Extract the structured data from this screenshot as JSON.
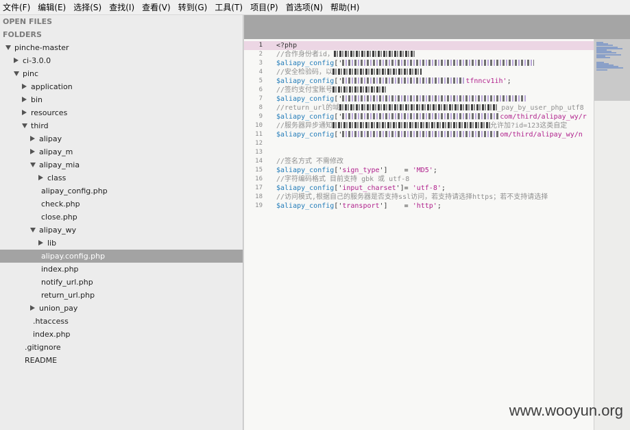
{
  "menu": [
    "文件(F)",
    "编辑(E)",
    "选择(S)",
    "查找(I)",
    "查看(V)",
    "转到(G)",
    "工具(T)",
    "项目(P)",
    "首选项(N)",
    "帮助(H)"
  ],
  "sidebar": {
    "open_files_label": "OPEN FILES",
    "folders_label": "FOLDERS",
    "tree": [
      {
        "label": "pinche-master",
        "depth": 0,
        "state": "open"
      },
      {
        "label": "ci-3.0.0",
        "depth": 1,
        "state": "closed"
      },
      {
        "label": "pinc",
        "depth": 1,
        "state": "open"
      },
      {
        "label": "application",
        "depth": 2,
        "state": "closed"
      },
      {
        "label": "bin",
        "depth": 2,
        "state": "closed"
      },
      {
        "label": "resources",
        "depth": 2,
        "state": "closed"
      },
      {
        "label": "third",
        "depth": 2,
        "state": "open"
      },
      {
        "label": "alipay",
        "depth": 3,
        "state": "closed"
      },
      {
        "label": "alipay_m",
        "depth": 3,
        "state": "closed"
      },
      {
        "label": "alipay_mia",
        "depth": 3,
        "state": "open"
      },
      {
        "label": "class",
        "depth": 4,
        "state": "closed"
      },
      {
        "label": "alipay_config.php",
        "depth": 4,
        "state": "file"
      },
      {
        "label": "check.php",
        "depth": 4,
        "state": "file"
      },
      {
        "label": "close.php",
        "depth": 4,
        "state": "file"
      },
      {
        "label": "alipay_wy",
        "depth": 3,
        "state": "open"
      },
      {
        "label": "lib",
        "depth": 4,
        "state": "closed"
      },
      {
        "label": "alipay.config.php",
        "depth": 4,
        "state": "file",
        "selected": true
      },
      {
        "label": "index.php",
        "depth": 4,
        "state": "file"
      },
      {
        "label": "notify_url.php",
        "depth": 4,
        "state": "file"
      },
      {
        "label": "return_url.php",
        "depth": 4,
        "state": "file"
      },
      {
        "label": "union_pay",
        "depth": 3,
        "state": "closed"
      },
      {
        "label": ".htaccess",
        "depth": 3,
        "state": "file"
      },
      {
        "label": "index.php",
        "depth": 3,
        "state": "file"
      },
      {
        "label": ".gitignore",
        "depth": 2,
        "state": "file"
      },
      {
        "label": "README",
        "depth": 2,
        "state": "file"
      }
    ]
  },
  "editor": {
    "current_line": 1,
    "lines": [
      {
        "n": 1,
        "parts": [
          {
            "t": "<?php",
            "c": "tag"
          }
        ]
      },
      {
        "n": 2,
        "parts": [
          {
            "t": "//合作身份者id，",
            "c": "comment"
          },
          {
            "m": 120,
            "d": true
          }
        ]
      },
      {
        "n": 3,
        "parts": [
          {
            "t": "$aliapy_config",
            "c": "var"
          },
          {
            "t": "['",
            "c": "op"
          },
          {
            "m": 280
          }
        ]
      },
      {
        "n": 4,
        "parts": [
          {
            "t": "//安全检验码，以",
            "c": "comment"
          },
          {
            "m": 130,
            "d": true
          }
        ]
      },
      {
        "n": 5,
        "parts": [
          {
            "t": "$aliapy_config",
            "c": "var"
          },
          {
            "t": "['",
            "c": "op"
          },
          {
            "m": 180
          },
          {
            "t": "tfnncv1ih'",
            "c": "str"
          },
          {
            "t": ";",
            "c": "op"
          }
        ]
      },
      {
        "n": 6,
        "parts": [
          {
            "t": "//签约支付宝账号",
            "c": "comment"
          },
          {
            "m": 80,
            "d": true
          }
        ]
      },
      {
        "n": 7,
        "parts": [
          {
            "t": "$aliapy_config",
            "c": "var"
          },
          {
            "t": "['",
            "c": "op"
          },
          {
            "m": 270
          }
        ]
      },
      {
        "n": 8,
        "parts": [
          {
            "t": "//return_url的域",
            "c": "comment"
          },
          {
            "m": 230,
            "d": true
          },
          {
            "t": "_pay_by_user_php_utf8",
            "c": "comment"
          }
        ]
      },
      {
        "n": 9,
        "parts": [
          {
            "t": "$aliapy_config",
            "c": "var"
          },
          {
            "t": "['",
            "c": "op"
          },
          {
            "m": 230
          },
          {
            "t": "com/third/alipay_wy/r",
            "c": "str"
          }
        ]
      },
      {
        "n": 10,
        "parts": [
          {
            "t": "//服务器异步通知",
            "c": "comment"
          },
          {
            "m": 230,
            "d": true
          },
          {
            "t": "允许加?id=123这类自定",
            "c": "comment"
          }
        ]
      },
      {
        "n": 11,
        "parts": [
          {
            "t": "$aliapy_config",
            "c": "var"
          },
          {
            "t": "['",
            "c": "op"
          },
          {
            "m": 230
          },
          {
            "t": "om/third/alipay_wy/n",
            "c": "str"
          }
        ]
      },
      {
        "n": 12,
        "parts": []
      },
      {
        "n": 13,
        "parts": []
      },
      {
        "n": 14,
        "parts": [
          {
            "t": "//签名方式 不需修改",
            "c": "comment"
          }
        ]
      },
      {
        "n": 15,
        "parts": [
          {
            "t": "$aliapy_config",
            "c": "var"
          },
          {
            "t": "['",
            "c": "op"
          },
          {
            "t": "sign_type",
            "c": "str"
          },
          {
            "t": "']    = ",
            "c": "op"
          },
          {
            "t": "'MD5'",
            "c": "str"
          },
          {
            "t": ";",
            "c": "op"
          }
        ]
      },
      {
        "n": 16,
        "parts": [
          {
            "t": "//字符编码格式 目前支持 gbk 或 utf-8",
            "c": "comment"
          }
        ]
      },
      {
        "n": 17,
        "parts": [
          {
            "t": "$aliapy_config",
            "c": "var"
          },
          {
            "t": "['",
            "c": "op"
          },
          {
            "t": "input_charset",
            "c": "str"
          },
          {
            "t": "']= ",
            "c": "op"
          },
          {
            "t": "'utf-8'",
            "c": "str"
          },
          {
            "t": ";",
            "c": "op"
          }
        ]
      },
      {
        "n": 18,
        "parts": [
          {
            "t": "//访问模式,根据自己的服务器是否支持ssl访问，若支持请选择https；若不支持请选择",
            "c": "comment"
          }
        ]
      },
      {
        "n": 19,
        "parts": [
          {
            "t": "$aliapy_config",
            "c": "var"
          },
          {
            "t": "['",
            "c": "op"
          },
          {
            "t": "transport",
            "c": "str"
          },
          {
            "t": "']    = ",
            "c": "op"
          },
          {
            "t": "'http'",
            "c": "str"
          },
          {
            "t": ";",
            "c": "op"
          }
        ]
      }
    ]
  },
  "watermark": "www.wooyun.org"
}
